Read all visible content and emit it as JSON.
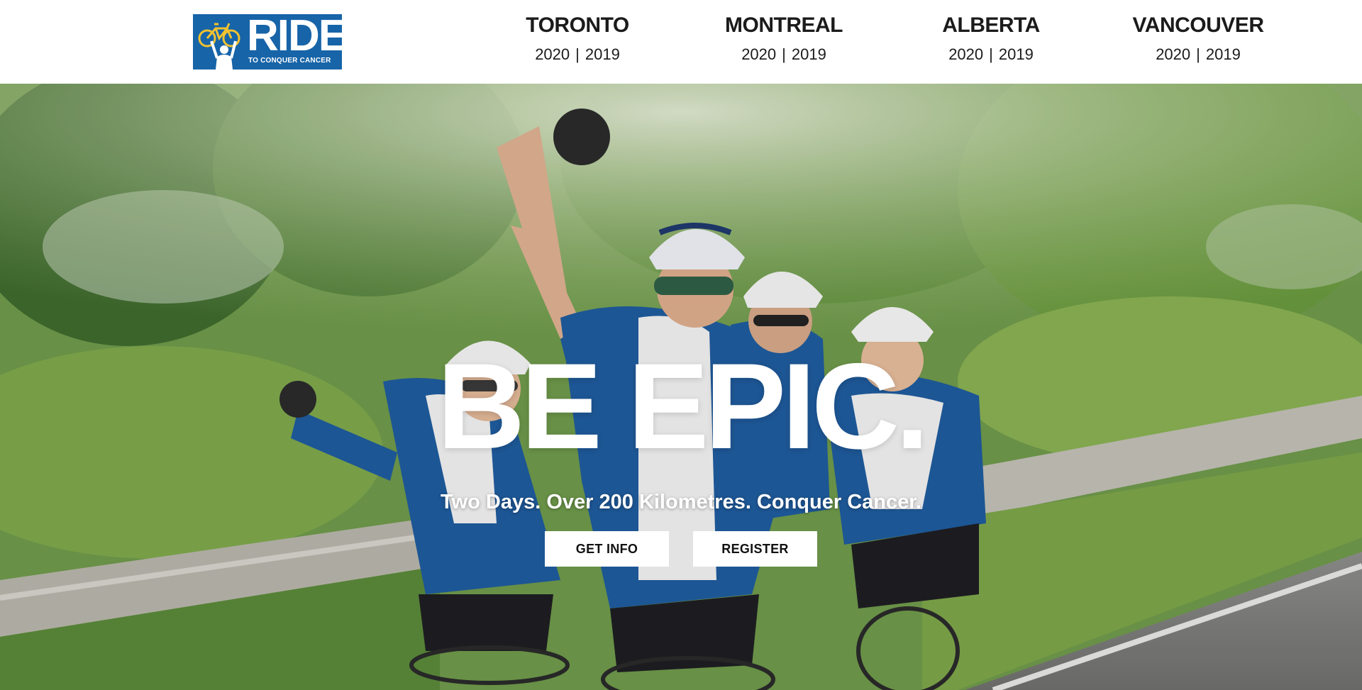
{
  "brand": {
    "logo_word": "RIDE",
    "logo_tagline": "TO CONQUER CANCER",
    "logo_color": "#1764a8",
    "logo_icon": "cyclist-with-bike-icon"
  },
  "nav": [
    {
      "city": "TORONTO",
      "years": [
        "2020",
        "2019"
      ]
    },
    {
      "city": "MONTREAL",
      "years": [
        "2020",
        "2019"
      ]
    },
    {
      "city": "ALBERTA",
      "years": [
        "2020",
        "2019"
      ]
    },
    {
      "city": "VANCOUVER",
      "years": [
        "2020",
        "2019"
      ]
    }
  ],
  "nav_separator": "|",
  "hero": {
    "title": "BE EPIC.",
    "subtitle": "Two Days. Over 200 Kilometres. Conquer Cancer.",
    "buttons": {
      "get_info": "GET INFO",
      "register": "REGISTER"
    }
  },
  "colors": {
    "text_dark": "#1b1b1b",
    "jersey_blue": "#1f5c9e",
    "button_bg": "#ffffff"
  }
}
